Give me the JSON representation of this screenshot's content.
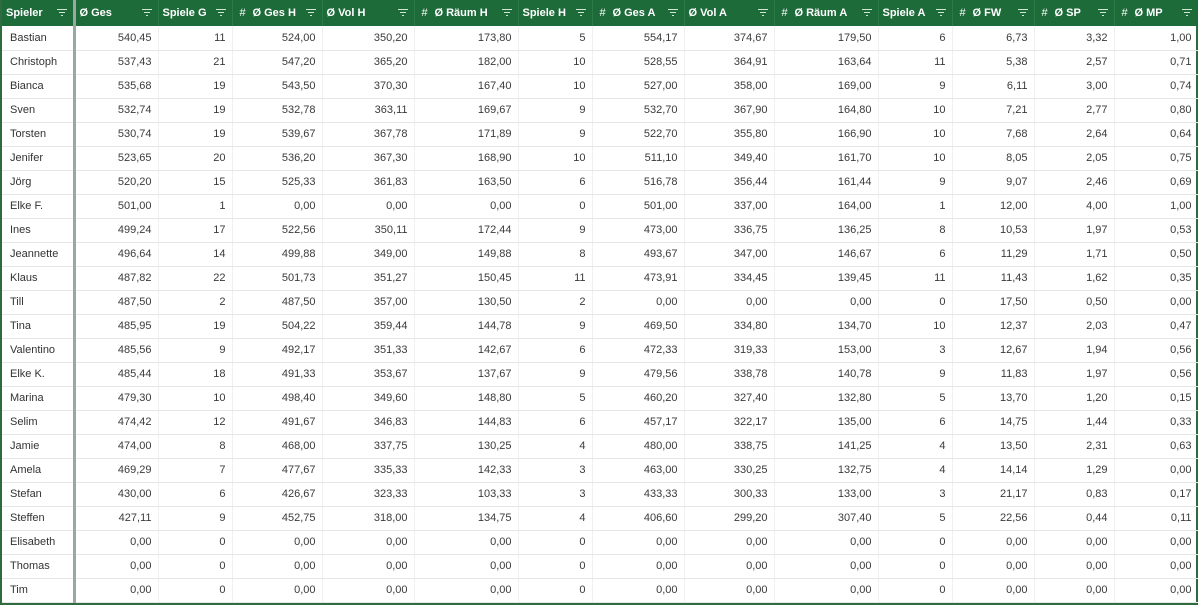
{
  "table": {
    "columns": [
      {
        "label": "Spieler",
        "hash": false
      },
      {
        "label": "Ø Ges",
        "hash": false
      },
      {
        "label": "Spiele G",
        "hash": false
      },
      {
        "label": "Ø Ges H",
        "hash": true
      },
      {
        "label": "Ø Vol H",
        "hash": false
      },
      {
        "label": "Ø Räum H",
        "hash": true
      },
      {
        "label": "Spiele H",
        "hash": false
      },
      {
        "label": "Ø Ges A",
        "hash": true
      },
      {
        "label": "Ø Vol A",
        "hash": false
      },
      {
        "label": "Ø Räum A",
        "hash": true
      },
      {
        "label": "Spiele A",
        "hash": false
      },
      {
        "label": "Ø FW",
        "hash": true
      },
      {
        "label": "Ø SP",
        "hash": true
      },
      {
        "label": "Ø MP",
        "hash": true
      }
    ],
    "rows": [
      [
        "Bastian",
        "540,45",
        "11",
        "524,00",
        "350,20",
        "173,80",
        "5",
        "554,17",
        "374,67",
        "179,50",
        "6",
        "6,73",
        "3,32",
        "1,00"
      ],
      [
        "Christoph",
        "537,43",
        "21",
        "547,20",
        "365,20",
        "182,00",
        "10",
        "528,55",
        "364,91",
        "163,64",
        "11",
        "5,38",
        "2,57",
        "0,71"
      ],
      [
        "Bianca",
        "535,68",
        "19",
        "543,50",
        "370,30",
        "167,40",
        "10",
        "527,00",
        "358,00",
        "169,00",
        "9",
        "6,11",
        "3,00",
        "0,74"
      ],
      [
        "Sven",
        "532,74",
        "19",
        "532,78",
        "363,11",
        "169,67",
        "9",
        "532,70",
        "367,90",
        "164,80",
        "10",
        "7,21",
        "2,77",
        "0,80"
      ],
      [
        "Torsten",
        "530,74",
        "19",
        "539,67",
        "367,78",
        "171,89",
        "9",
        "522,70",
        "355,80",
        "166,90",
        "10",
        "7,68",
        "2,64",
        "0,64"
      ],
      [
        "Jenifer",
        "523,65",
        "20",
        "536,20",
        "367,30",
        "168,90",
        "10",
        "511,10",
        "349,40",
        "161,70",
        "10",
        "8,05",
        "2,05",
        "0,75"
      ],
      [
        "Jörg",
        "520,20",
        "15",
        "525,33",
        "361,83",
        "163,50",
        "6",
        "516,78",
        "356,44",
        "161,44",
        "9",
        "9,07",
        "2,46",
        "0,69"
      ],
      [
        "Elke F.",
        "501,00",
        "1",
        "0,00",
        "0,00",
        "0,00",
        "0",
        "501,00",
        "337,00",
        "164,00",
        "1",
        "12,00",
        "4,00",
        "1,00"
      ],
      [
        "Ines",
        "499,24",
        "17",
        "522,56",
        "350,11",
        "172,44",
        "9",
        "473,00",
        "336,75",
        "136,25",
        "8",
        "10,53",
        "1,97",
        "0,53"
      ],
      [
        "Jeannette",
        "496,64",
        "14",
        "499,88",
        "349,00",
        "149,88",
        "8",
        "493,67",
        "347,00",
        "146,67",
        "6",
        "11,29",
        "1,71",
        "0,50"
      ],
      [
        "Klaus",
        "487,82",
        "22",
        "501,73",
        "351,27",
        "150,45",
        "11",
        "473,91",
        "334,45",
        "139,45",
        "11",
        "11,43",
        "1,62",
        "0,35"
      ],
      [
        "Till",
        "487,50",
        "2",
        "487,50",
        "357,00",
        "130,50",
        "2",
        "0,00",
        "0,00",
        "0,00",
        "0",
        "17,50",
        "0,50",
        "0,00"
      ],
      [
        "Tina",
        "485,95",
        "19",
        "504,22",
        "359,44",
        "144,78",
        "9",
        "469,50",
        "334,80",
        "134,70",
        "10",
        "12,37",
        "2,03",
        "0,47"
      ],
      [
        "Valentino",
        "485,56",
        "9",
        "492,17",
        "351,33",
        "142,67",
        "6",
        "472,33",
        "319,33",
        "153,00",
        "3",
        "12,67",
        "1,94",
        "0,56"
      ],
      [
        "Elke K.",
        "485,44",
        "18",
        "491,33",
        "353,67",
        "137,67",
        "9",
        "479,56",
        "338,78",
        "140,78",
        "9",
        "11,83",
        "1,97",
        "0,56"
      ],
      [
        "Marina",
        "479,30",
        "10",
        "498,40",
        "349,60",
        "148,80",
        "5",
        "460,20",
        "327,40",
        "132,80",
        "5",
        "13,70",
        "1,20",
        "0,15"
      ],
      [
        "Selim",
        "474,42",
        "12",
        "491,67",
        "346,83",
        "144,83",
        "6",
        "457,17",
        "322,17",
        "135,00",
        "6",
        "14,75",
        "1,44",
        "0,33"
      ],
      [
        "Jamie",
        "474,00",
        "8",
        "468,00",
        "337,75",
        "130,25",
        "4",
        "480,00",
        "338,75",
        "141,25",
        "4",
        "13,50",
        "2,31",
        "0,63"
      ],
      [
        "Amela",
        "469,29",
        "7",
        "477,67",
        "335,33",
        "142,33",
        "3",
        "463,00",
        "330,25",
        "132,75",
        "4",
        "14,14",
        "1,29",
        "0,00"
      ],
      [
        "Stefan",
        "430,00",
        "6",
        "426,67",
        "323,33",
        "103,33",
        "3",
        "433,33",
        "300,33",
        "133,00",
        "3",
        "21,17",
        "0,83",
        "0,17"
      ],
      [
        "Steffen",
        "427,11",
        "9",
        "452,75",
        "318,00",
        "134,75",
        "4",
        "406,60",
        "299,20",
        "307,40",
        "5",
        "22,56",
        "0,44",
        "0,11"
      ],
      [
        "Elisabeth",
        "0,00",
        "0",
        "0,00",
        "0,00",
        "0,00",
        "0",
        "0,00",
        "0,00",
        "0,00",
        "0",
        "0,00",
        "0,00",
        "0,00"
      ],
      [
        "Thomas",
        "0,00",
        "0",
        "0,00",
        "0,00",
        "0,00",
        "0",
        "0,00",
        "0,00",
        "0,00",
        "0",
        "0,00",
        "0,00",
        "0,00"
      ],
      [
        "Tim",
        "0,00",
        "0",
        "0,00",
        "0,00",
        "0,00",
        "0",
        "0,00",
        "0,00",
        "0,00",
        "0",
        "0,00",
        "0,00",
        "0,00"
      ]
    ]
  },
  "colors": {
    "header_bg": "#1e6b3a",
    "header_text": "#ffffff",
    "frame": "#2e6b3f"
  },
  "icons": {
    "filter": "filter-icon"
  }
}
